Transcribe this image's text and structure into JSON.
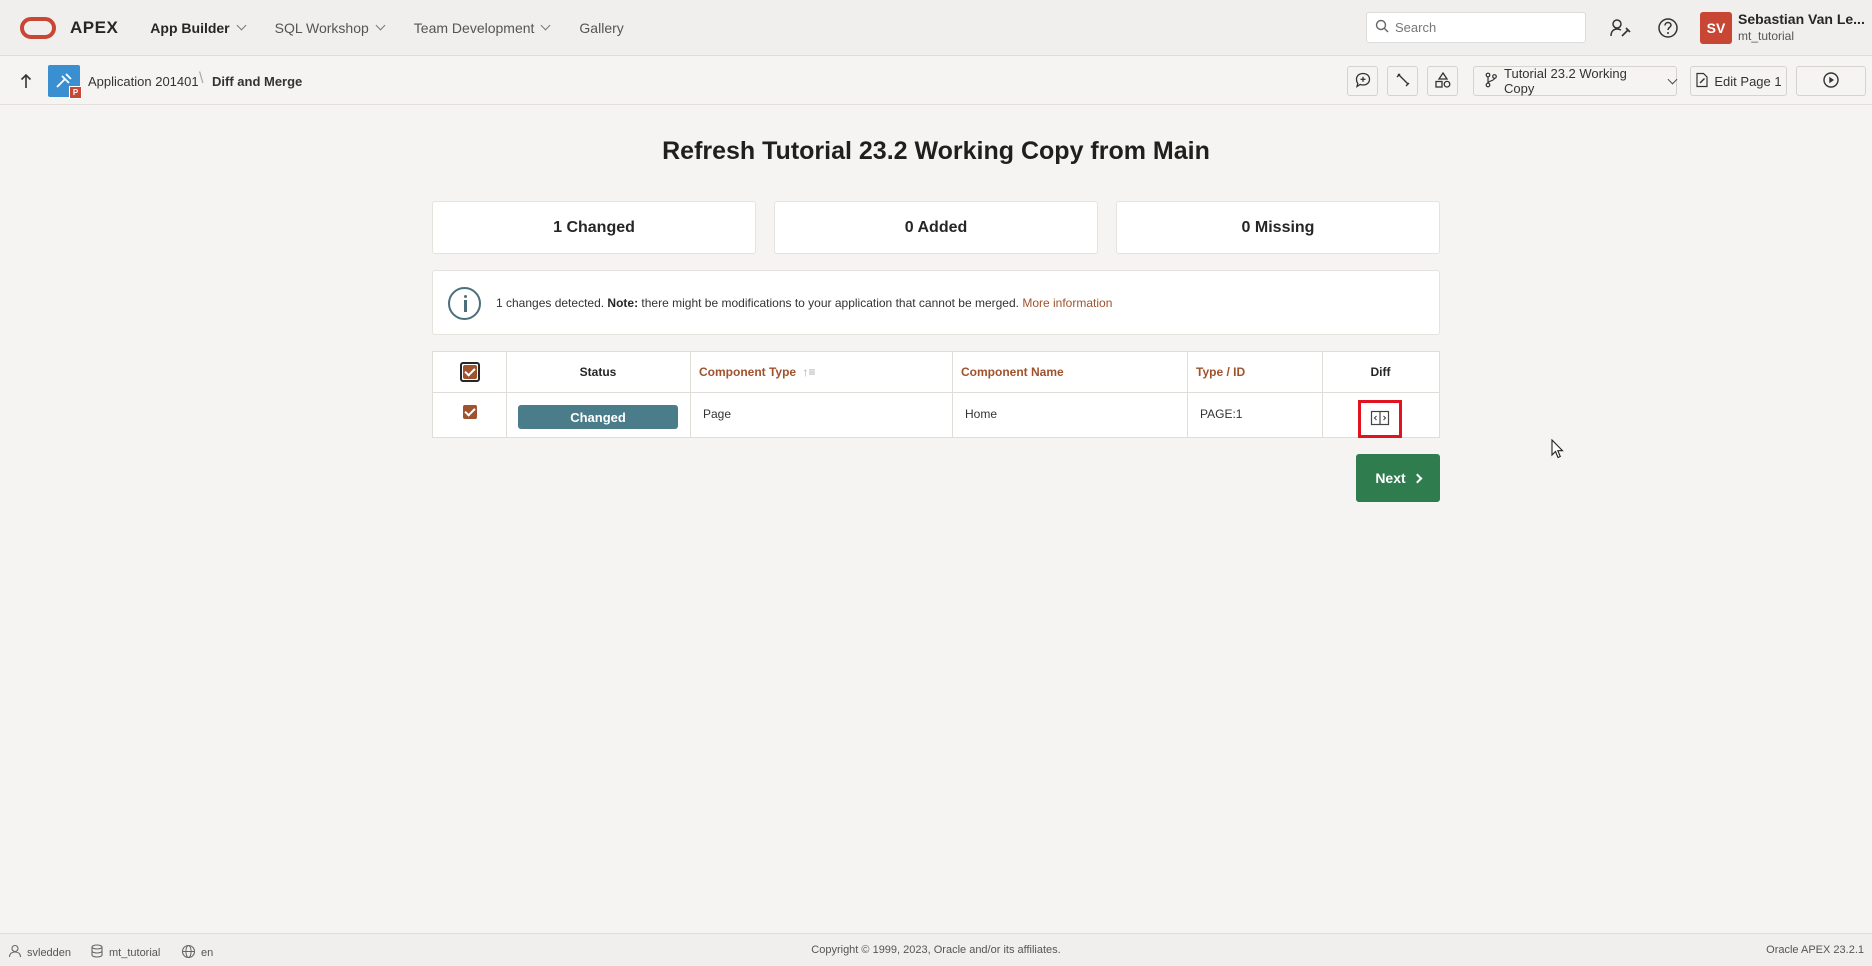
{
  "header": {
    "brand": "APEX",
    "nav": [
      {
        "label": "App Builder",
        "active": true,
        "has_menu": true
      },
      {
        "label": "SQL Workshop",
        "has_menu": true
      },
      {
        "label": "Team Development",
        "has_menu": true
      },
      {
        "label": "Gallery",
        "has_menu": false
      }
    ],
    "search_placeholder": "Search",
    "user": {
      "initials": "SV",
      "name": "Sebastian Van Le...",
      "workspace": "mt_tutorial"
    }
  },
  "subbar": {
    "app_badge": "P",
    "breadcrumb_app": "Application 201401",
    "breadcrumb_current": "Diff and Merge",
    "working_copy": "Tutorial 23.2 Working Copy",
    "edit_page": "Edit Page 1"
  },
  "main": {
    "title": "Refresh Tutorial 23.2 Working Copy from Main",
    "stats": {
      "changed": "1 Changed",
      "added": "0 Added",
      "missing": "0 Missing"
    },
    "alert": {
      "prefix": "1 changes detected. ",
      "note_label": "Note:",
      "text": " there might be modifications to your application that cannot be merged. ",
      "link": "More information"
    },
    "table": {
      "headers": {
        "status": "Status",
        "component_type": "Component Type",
        "component_name": "Component Name",
        "type_id": "Type / ID",
        "diff": "Diff"
      },
      "rows": [
        {
          "checked": true,
          "status": "Changed",
          "component_type": "Page",
          "component_name": "Home",
          "type_id": "PAGE:1"
        }
      ]
    },
    "next_label": "Next"
  },
  "footer": {
    "user": "svledden",
    "workspace": "mt_tutorial",
    "language": "en",
    "copyright": "Copyright © 1999, 2023, Oracle and/or its affiliates.",
    "version": "Oracle APEX 23.2.1"
  },
  "colors": {
    "accent": "#a0522d",
    "brand": "#c74634",
    "status_changed": "#4b7c8a",
    "primary_button": "#2f7d4f",
    "highlight": "#e0141e"
  }
}
